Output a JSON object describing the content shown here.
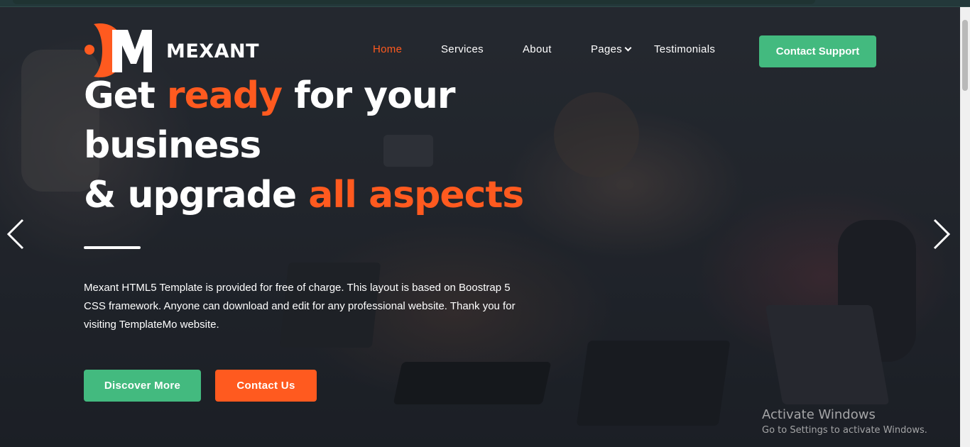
{
  "brand": {
    "name": "MEXANT",
    "accent_color": "#ff5a1f",
    "green_color": "#43ba7f"
  },
  "nav": {
    "items": [
      {
        "label": "Home",
        "active": true
      },
      {
        "label": "Services"
      },
      {
        "label": "About"
      },
      {
        "label": "Pages",
        "has_dropdown": true
      },
      {
        "label": "Testimonials"
      }
    ],
    "cta_label": "Contact Support"
  },
  "hero": {
    "headline": {
      "line1_a": "Get ",
      "line1_accent": "ready",
      "line1_b": " for your",
      "line2": "business",
      "line3_a": "& upgrade ",
      "line3_accent": "all aspects"
    },
    "description": "Mexant HTML5 Template is provided for free of charge. This layout is based on Boostrap 5 CSS framework. Anyone can download and edit for any professional website. Thank you for visiting TemplateMo website.",
    "buttons": {
      "discover": "Discover More",
      "contact": "Contact Us"
    },
    "icons": {
      "prev": "chevron-left-icon",
      "next": "chevron-right-icon"
    }
  },
  "watermark": {
    "title": "Activate Windows",
    "subtitle": "Go to Settings to activate Windows."
  }
}
